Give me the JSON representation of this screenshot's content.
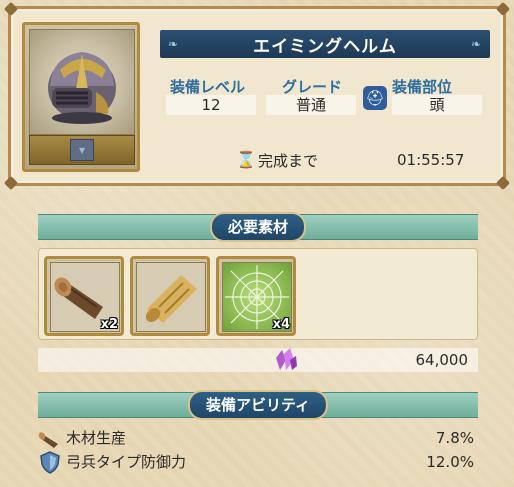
{
  "equipment": {
    "name": "エイミングヘルム",
    "stats": [
      {
        "label": "装備レベル",
        "value": "12"
      },
      {
        "label": "グレード",
        "value": "普通"
      },
      {
        "label": "装備部位",
        "value": "頭"
      }
    ],
    "slot_icon": "helmet-slot-icon",
    "timer": {
      "label": "完成まで",
      "value": "01:55:57"
    }
  },
  "materials_section": {
    "title": "必要素材",
    "items": [
      {
        "icon": "wood-log-icon",
        "qty": "x2"
      },
      {
        "icon": "parchment-scroll-icon",
        "qty": ""
      },
      {
        "icon": "spider-web-icon",
        "qty": "x4"
      }
    ],
    "cost": {
      "icon": "purple-crystal-icon",
      "value": "64,000"
    }
  },
  "abilities_section": {
    "title": "装備アビリティ",
    "items": [
      {
        "icon": "wood-log-icon",
        "name": "木材生産",
        "value": "7.8%"
      },
      {
        "icon": "shield-icon",
        "name": "弓兵タイプ防御力",
        "value": "12.0%"
      }
    ]
  },
  "colors": {
    "title_bar": "#1f4668",
    "label_blue": "#2d6da0",
    "banner_teal": "#6fae9c",
    "frame_gold": "#b08a3d"
  }
}
